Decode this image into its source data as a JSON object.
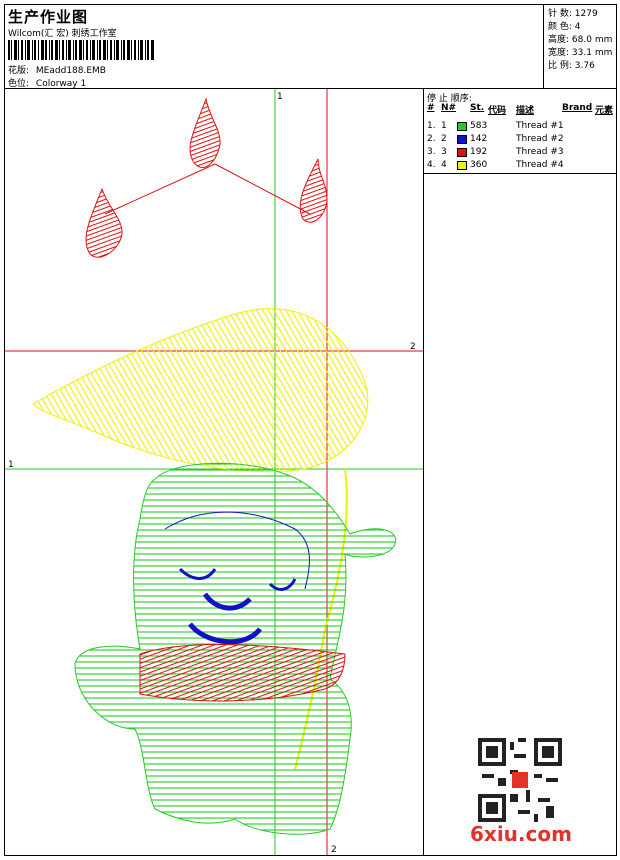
{
  "header": {
    "title": "生产作业图",
    "company": "Wilcom(汇 宏) 刺绣工作室",
    "design_label": "花版:",
    "design_value": "MEadd188.EMB",
    "colorway_label": "色位:",
    "colorway_value": "Colorway 1"
  },
  "stats": [
    {
      "label": "针 数:",
      "value": "1279"
    },
    {
      "label": "颜 色:",
      "value": "4"
    },
    {
      "label": "高度:",
      "value": "68.0 mm"
    },
    {
      "label": "宽度:",
      "value": "33.1 mm"
    },
    {
      "label": "比 例:",
      "value": "3.76"
    }
  ],
  "stop_sequence": {
    "title": "停 止 顺序:",
    "columns": {
      "num": "#",
      "n": "N#",
      "st": "St.",
      "code": "代码",
      "desc": "描述",
      "brand": "Brand",
      "element": "元素"
    },
    "rows": [
      {
        "num": "1.",
        "n": "1",
        "color": "#22cc22",
        "code": "583",
        "desc": "Thread #1"
      },
      {
        "num": "2.",
        "n": "2",
        "color": "#1111cc",
        "code": "142",
        "desc": "Thread #2"
      },
      {
        "num": "3.",
        "n": "3",
        "color": "#dd1111",
        "code": "192",
        "desc": "Thread #3"
      },
      {
        "num": "4.",
        "n": "4",
        "color": "#f2f200",
        "code": "360",
        "desc": "Thread #4"
      }
    ]
  },
  "canvas": {
    "guide_labels": {
      "v1": "1",
      "v2": "2",
      "h1": "1",
      "h2": "2"
    }
  },
  "watermark": "6xiu.com"
}
